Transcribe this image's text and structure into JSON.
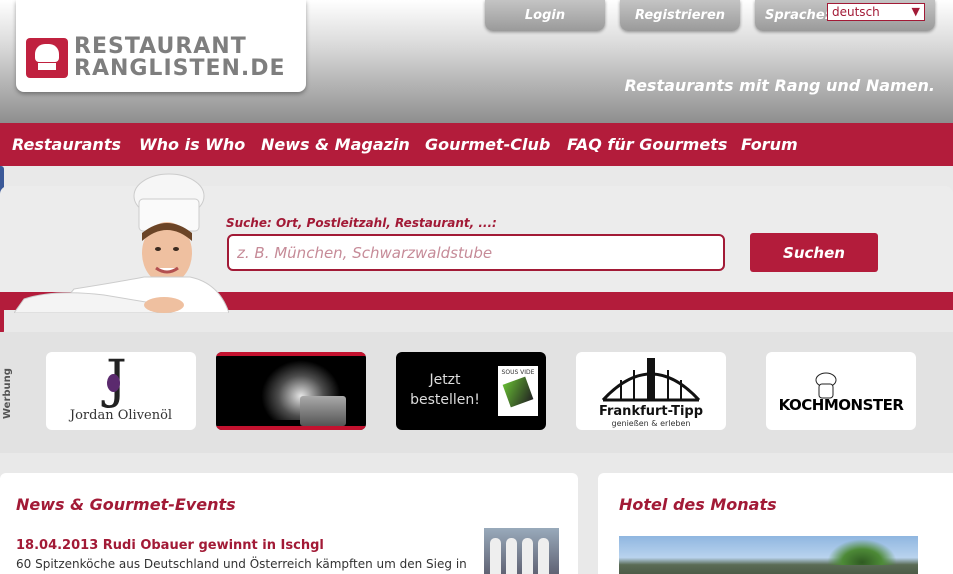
{
  "header": {
    "logo_line1": "RESTAURANT",
    "logo_line2": "RANGLISTEN.DE",
    "login_label": "Login",
    "register_label": "Registrieren",
    "language_label": "Sprache:",
    "language_value": "deutsch",
    "slogan": "Restaurants mit Rang und Namen."
  },
  "nav": {
    "items": [
      {
        "label": "Restaurants"
      },
      {
        "label": "Who is Who"
      },
      {
        "label": "News & Magazin"
      },
      {
        "label": "Gourmet-Club"
      },
      {
        "label": "FAQ für Gourmets"
      },
      {
        "label": "Forum"
      }
    ]
  },
  "search": {
    "label": "Suche: Ort, Postleitzahl, Restaurant, ...:",
    "placeholder": "z. B. München, Schwarzwaldstube",
    "button_label": "Suchen"
  },
  "ads": {
    "label": "Werbung",
    "jordan": "Jordan Olivenöl",
    "jetzt": "Jetzt bestellen!",
    "sous_vide": "SOUS VIDE",
    "frankfurt": "Frankfurt-Tipp",
    "frankfurt_sub": "genießen & erleben",
    "koch": "KOCHMONSTER"
  },
  "news": {
    "title": "News & Gourmet-Events",
    "headline": "18.04.2013 Rudi Obauer gewinnt in Ischgl",
    "text": "60 Spitzenköche aus Deutschland und Österreich kämpften um den Sieg in"
  },
  "hotel": {
    "title": "Hotel des Monats"
  },
  "colors": {
    "brand_red": "#b31c3b",
    "text_red": "#a21a36"
  }
}
